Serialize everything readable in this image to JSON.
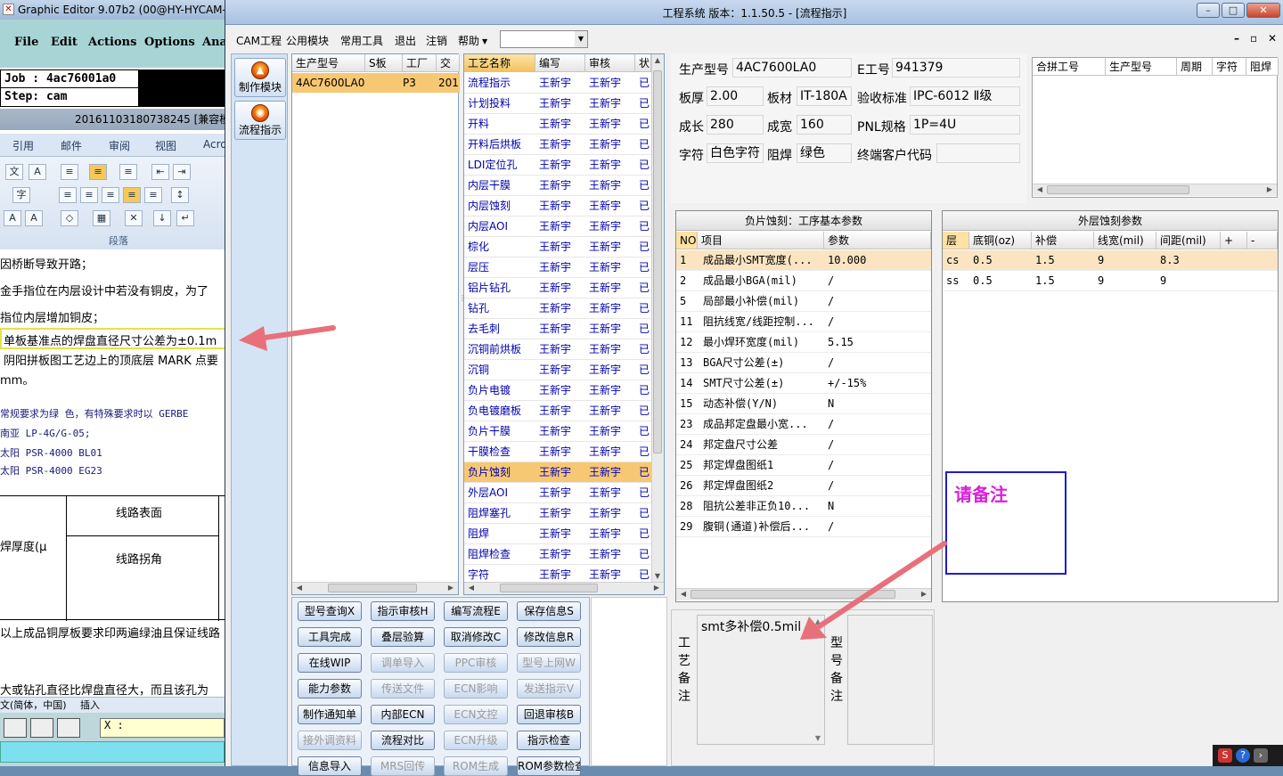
{
  "bg_editor": {
    "title": "Graphic Editor 9.07b2 (00@HY-HYCAM-",
    "menu": [
      "File",
      "Edit",
      "Actions",
      "Options",
      "Ana"
    ],
    "job_line": "Job : 4ac76001a0",
    "step_line": "Step: cam",
    "doc_title": "20161103180738245 [兼容模式",
    "ribbon_tabs": [
      "引用",
      "邮件",
      "审阅",
      "视图",
      "Acro"
    ],
    "ribbon_group": "段落",
    "doc_lines": [
      "因桥断导致开路；",
      "金手指位在内层设计中若没有铜皮，为了",
      "指位内层增加铜皮；",
      "单板基准点的焊盘直径尺寸公差为±0.1m",
      "阴阳拼板图工艺边上的顶底层 MARK  点要",
      "mm。"
    ],
    "doc_blue_lines": [
      "常规要求为绿  色，有特殊要求时以  GERBE",
      " 南亚  LP-4G/G-05;",
      "太阳  PSR-4000  BL01",
      "太阳  PSR-4000  EG23"
    ],
    "table": {
      "cell_a": "焊厚度(μ",
      "cell_b": "线路表面",
      "cell_c": "线路拐角"
    },
    "doc_bottom_lines": [
      "以上成品铜厚板要求印两遍绿油且保证线路",
      "大或钻孔直径比焊盘直径大，而且该孔为"
    ],
    "status": [
      "文(简体，中国)",
      "插入"
    ],
    "coord": "X :"
  },
  "window": {
    "title": "工程系统   版本：1.1.50.5 - [流程指示]",
    "controls": [
      "–",
      "□",
      "✕"
    ]
  },
  "menu": [
    "CAM工程",
    "公用模块",
    "常用工具",
    "退出",
    "注销",
    "帮助"
  ],
  "nav": [
    {
      "label": "制作模块",
      "icon": "module-icon"
    },
    {
      "label": "流程指示",
      "icon": "flow-icon"
    }
  ],
  "product_list": {
    "headers": [
      "生产型号",
      "S板",
      "工厂",
      "交"
    ],
    "rows": [
      [
        "4AC7600LA0",
        "",
        "P3",
        "201"
      ]
    ]
  },
  "process_list": {
    "headers": [
      "工艺名称",
      "编写",
      "审核",
      "状"
    ],
    "rows": [
      [
        "流程指示",
        "王新宇",
        "王新宇",
        "已"
      ],
      [
        "计划投料",
        "王新宇",
        "王新宇",
        "已"
      ],
      [
        "开料",
        "王新宇",
        "王新宇",
        "已"
      ],
      [
        "开料后烘板",
        "王新宇",
        "王新宇",
        "已"
      ],
      [
        "LDI定位孔",
        "王新宇",
        "王新宇",
        "已"
      ],
      [
        "内层干膜",
        "王新宇",
        "王新宇",
        "已"
      ],
      [
        "内层蚀刻",
        "王新宇",
        "王新宇",
        "已"
      ],
      [
        "内层AOI",
        "王新宇",
        "王新宇",
        "已"
      ],
      [
        "棕化",
        "王新宇",
        "王新宇",
        "已"
      ],
      [
        "层压",
        "王新宇",
        "王新宇",
        "已"
      ],
      [
        "铝片钻孔",
        "王新宇",
        "王新宇",
        "已"
      ],
      [
        "钻孔",
        "王新宇",
        "王新宇",
        "已"
      ],
      [
        "去毛刺",
        "王新宇",
        "王新宇",
        "已"
      ],
      [
        "沉铜前烘板",
        "王新宇",
        "王新宇",
        "已"
      ],
      [
        "沉铜",
        "王新宇",
        "王新宇",
        "已"
      ],
      [
        "负片电镀",
        "王新宇",
        "王新宇",
        "已"
      ],
      [
        "负电镀磨板",
        "王新宇",
        "王新宇",
        "已"
      ],
      [
        "负片干膜",
        "王新宇",
        "王新宇",
        "已"
      ],
      [
        "干膜检查",
        "王新宇",
        "王新宇",
        "已"
      ],
      [
        "负片蚀刻",
        "王新宇",
        "王新宇",
        "已"
      ],
      [
        "外层AOI",
        "王新宇",
        "王新宇",
        "已"
      ],
      [
        "阻焊塞孔",
        "王新宇",
        "王新宇",
        "已"
      ],
      [
        "阻焊",
        "王新宇",
        "王新宇",
        "已"
      ],
      [
        "阻焊检查",
        "王新宇",
        "王新宇",
        "已"
      ],
      [
        "字符",
        "王新宇",
        "王新宇",
        "已"
      ]
    ],
    "selected_index": 19
  },
  "buttons": [
    [
      {
        "label": "型号查询X",
        "enabled": true
      },
      {
        "label": "指示审核H",
        "enabled": true
      },
      {
        "label": "编写流程E",
        "enabled": true
      },
      {
        "label": "保存信息S",
        "enabled": true
      }
    ],
    [
      {
        "label": "工具完成",
        "enabled": true
      },
      {
        "label": "叠层验算",
        "enabled": true
      },
      {
        "label": "取消修改C",
        "enabled": true
      },
      {
        "label": "修改信息R",
        "enabled": true
      }
    ],
    [
      {
        "label": "在线WIP",
        "enabled": true
      },
      {
        "label": "调单导入",
        "enabled": false
      },
      {
        "label": "PPC审核",
        "enabled": false
      },
      {
        "label": "型号上网W",
        "enabled": false
      }
    ],
    [
      {
        "label": "能力参数",
        "enabled": true
      },
      {
        "label": "传送文件",
        "enabled": false
      },
      {
        "label": "ECN影响",
        "enabled": false
      },
      {
        "label": "发送指示V",
        "enabled": false
      }
    ],
    [
      {
        "label": "制作通知单",
        "enabled": true
      },
      {
        "label": "内部ECN",
        "enabled": true
      },
      {
        "label": "ECN文控",
        "enabled": false
      },
      {
        "label": "回退审核B",
        "enabled": true
      }
    ],
    [
      {
        "label": "接外调资料",
        "enabled": false
      },
      {
        "label": "流程对比",
        "enabled": true
      },
      {
        "label": "ECN升级",
        "enabled": false
      },
      {
        "label": "指示检查",
        "enabled": true
      }
    ],
    [
      {
        "label": "信息导入",
        "enabled": true
      },
      {
        "label": "MRS回传",
        "enabled": false
      },
      {
        "label": "ROM生成",
        "enabled": false
      },
      {
        "label": "ROM参数检查",
        "enabled": true
      }
    ]
  ],
  "info": {
    "model_label": "生产型号",
    "model": "4AC7600LA0",
    "eno_label": "E工号",
    "eno": "941379",
    "thick_label": "板厚",
    "thick": "2.00",
    "mat_label": "板材",
    "mat": "IT-180A",
    "std_label": "验收标准",
    "std": "IPC-6012 Ⅱ级",
    "len_label": "成长",
    "len": "280",
    "wid_label": "成宽",
    "wid": "160",
    "pnl_label": "PNL规格",
    "pnl": "1P=4U",
    "char_label": "字符",
    "char": "白色字符",
    "mask_label": "阻焊",
    "mask": "绿色",
    "cust_label": "终端客户代码",
    "cust": ""
  },
  "merge_table": {
    "headers": [
      "合拼工号",
      "生产型号",
      "周期",
      "字符",
      "阻焊"
    ]
  },
  "neg_etch": {
    "title": "负片蚀刻：工序基本参数",
    "headers": [
      "NO",
      "项目",
      "参数"
    ],
    "rows": [
      [
        "1",
        "成品最小SMT宽度(...",
        "10.000"
      ],
      [
        "2",
        "成品最小BGA(mil)",
        "/"
      ],
      [
        "5",
        "局部最小补偿(mil)",
        "/"
      ],
      [
        "11",
        "阻抗线宽/线距控制...",
        "/"
      ],
      [
        "12",
        "最小焊环宽度(mil)",
        "5.15"
      ],
      [
        "13",
        "BGA尺寸公差(±)",
        "/"
      ],
      [
        "14",
        "SMT尺寸公差(±)",
        "+/-15%"
      ],
      [
        "15",
        "动态补偿(Y/N)",
        "N"
      ],
      [
        "23",
        "成品邦定盘最小宽...",
        "/"
      ],
      [
        "24",
        "邦定盘尺寸公差",
        "/"
      ],
      [
        "25",
        "邦定焊盘图纸1",
        "/"
      ],
      [
        "26",
        "邦定焊盘图纸2",
        "/"
      ],
      [
        "28",
        "阻抗公差非正负10...",
        "N"
      ],
      [
        "29",
        "腹铜(通道)补偿后...",
        "/"
      ]
    ]
  },
  "outer_etch": {
    "title": "外层蚀刻参数",
    "headers": [
      "层",
      "底铜(oz)",
      "补偿",
      "线宽(mil)",
      "间距(mil)",
      "+",
      "-"
    ],
    "rows": [
      [
        "cs",
        "0.5",
        "1.5",
        "9",
        "8.3"
      ],
      [
        "ss",
        "0.5",
        "1.5",
        "9",
        "9"
      ]
    ]
  },
  "remark": {
    "process_label": [
      "工",
      "艺",
      "备",
      "注"
    ],
    "process_text": "smt多补偿0.5mil",
    "model_label": [
      "型",
      "号",
      "备",
      "注"
    ]
  },
  "note": "请备注",
  "colors": {
    "selected_row": "#f7c873",
    "accent_blue": "#0000aa",
    "annotation_arrow": "#e8707a",
    "note_border": "#1e1ec8",
    "note_text": "#d820d8"
  }
}
